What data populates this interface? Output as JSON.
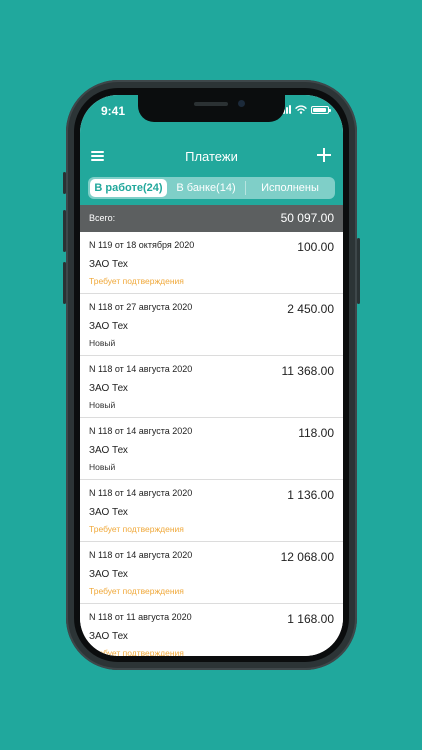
{
  "status_bar": {
    "time": "9:41"
  },
  "header": {
    "title": "Платежи",
    "tabs": [
      {
        "label": "В работе(24)"
      },
      {
        "label": "В банке(14)"
      },
      {
        "label": "Исполнены"
      }
    ]
  },
  "summary": {
    "label": "Всего:",
    "value": "50 097.00"
  },
  "payments": [
    {
      "number": "N 119 от 18 октября 2020",
      "org": "ЗАО Тех",
      "status": "Требует подтверждения",
      "amount": "100.00"
    },
    {
      "number": "N 118 от 27 августа 2020",
      "org": "ЗАО Тех",
      "status": "Новый",
      "amount": "2 450.00"
    },
    {
      "number": "N 118 от 14 августа 2020",
      "org": "ЗАО Тех",
      "status": "Новый",
      "amount": "11 368.00"
    },
    {
      "number": "N 118 от 14 августа 2020",
      "org": "ЗАО Тех",
      "status": "Новый",
      "amount": "118.00"
    },
    {
      "number": "N 118 от 14 августа 2020",
      "org": "ЗАО Тех",
      "status": "Требует подтверждения",
      "amount": "1 136.00"
    },
    {
      "number": "N 118 от 14 августа 2020",
      "org": "ЗАО Тех",
      "status": "Требует подтверждения",
      "amount": "12 068.00"
    },
    {
      "number": "N 118 от 11 августа 2020",
      "org": "ЗАО Тех",
      "status": "Требует подтверждения",
      "amount": "1 168.00"
    }
  ],
  "colors": {
    "accent": "#22a89c",
    "pending": "#f0a93b",
    "summary_bg": "#5c5f60"
  }
}
